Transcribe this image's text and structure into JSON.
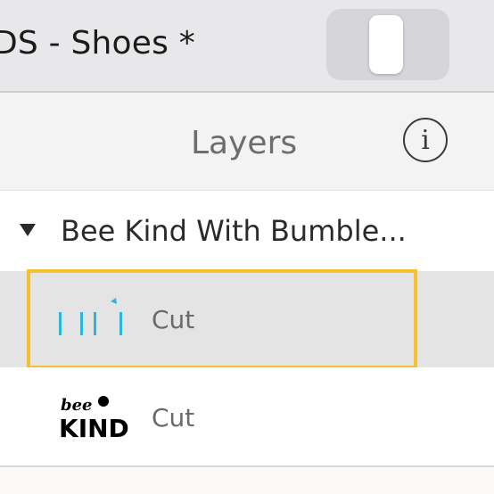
{
  "topbar": {
    "project_title": "DS - Shoes *",
    "toggle": {
      "on": true
    }
  },
  "panel": {
    "title": "Layers",
    "info_icon_glyph": "i"
  },
  "group": {
    "name": "Bee Kind With Bumble...",
    "expanded": true
  },
  "layers": [
    {
      "operation": "Cut",
      "selected": true,
      "thumbnail": "cyan-bars-icon",
      "thumb_color": "#2bb7dd"
    },
    {
      "operation": "Cut",
      "selected": false,
      "thumbnail": "bee-kind-icon",
      "thumb_text_top": "bee",
      "thumb_text_bottom": "KIND",
      "thumb_color": "#000000"
    }
  ],
  "colors": {
    "selection": "#f5c12e",
    "topbar": "#e8e8ea",
    "selected_row": "#e4e4e4"
  }
}
